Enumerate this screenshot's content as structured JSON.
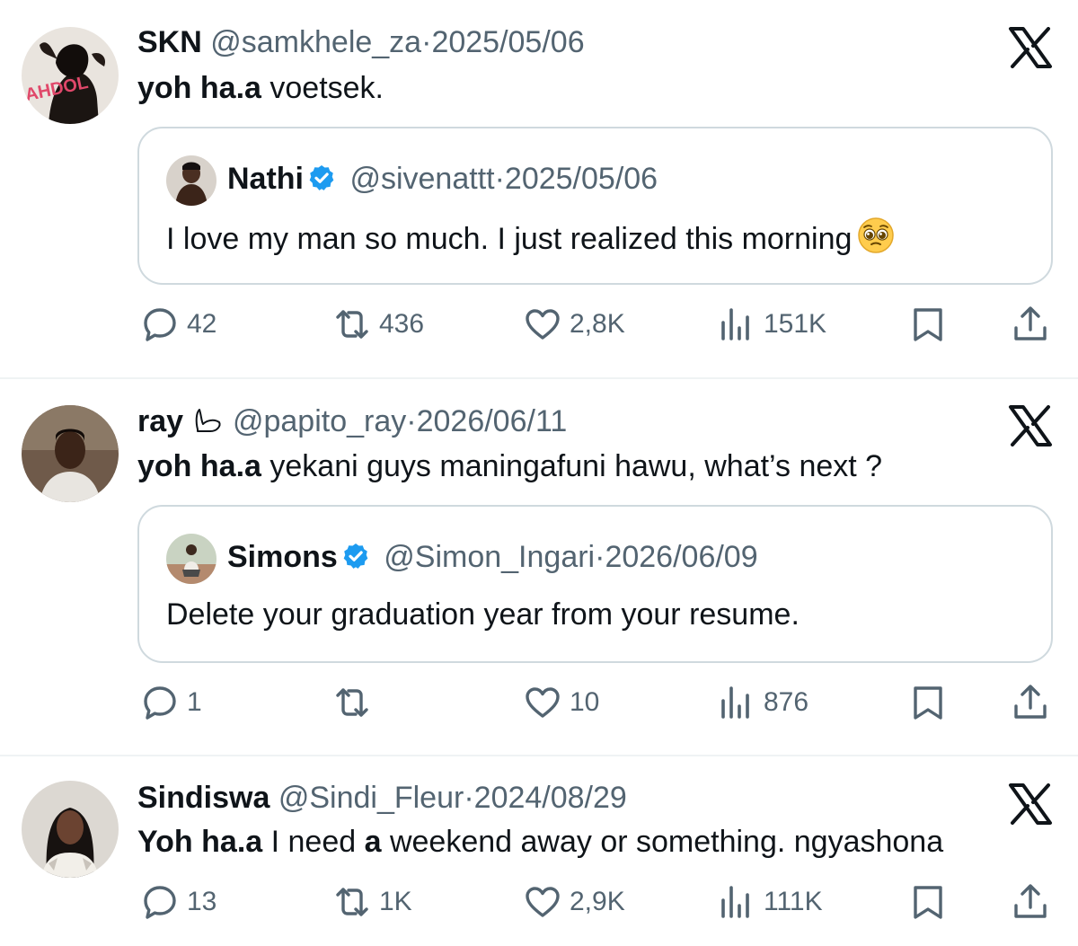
{
  "tweets": [
    {
      "name": "SKN",
      "handle": "@samkhele_za",
      "dot": "·",
      "date": "2025/05/06",
      "text_bold": "yoh ha.a",
      "text_rest": " voetsek.",
      "avatar_text": "AHDOL",
      "quote": {
        "name": "Nathi",
        "handle": "@sivenattt",
        "dot": "·",
        "date": "2025/05/06",
        "text": "I love my man so much. I just realized this morning",
        "emoji": "pleading-face"
      },
      "stats": {
        "replies": "42",
        "reposts": "436",
        "likes": "2,8K",
        "views": "151K"
      }
    },
    {
      "name": "ray",
      "handle": "@papito_ray",
      "dot": "·",
      "date": "2026/06/11",
      "name_glyph": "whale-outline-icon",
      "text_bold": "yoh ha.a",
      "text_rest": " yekani guys maningafuni hawu, what’s next ?",
      "quote": {
        "name": "Simons",
        "handle": "@Simon_Ingari",
        "dot": "·",
        "date": "2026/06/09",
        "text": "Delete your graduation year from your resume."
      },
      "stats": {
        "replies": "1",
        "reposts": "",
        "likes": "10",
        "views": "876"
      }
    },
    {
      "name": "Sindiswa",
      "handle": "@Sindi_Fleur",
      "dot": "·",
      "date": "2024/08/29",
      "text_bold": "Yoh ha.a",
      "text_mid": " I need ",
      "text_bold2": "a",
      "text_rest": " weekend away or something. ngyashona",
      "stats": {
        "replies": "13",
        "reposts": "1K",
        "likes": "2,9K",
        "views": "111K"
      }
    }
  ],
  "colors": {
    "text": "#0f1419",
    "muted": "#536471",
    "verified": "#1d9bf0",
    "border": "#cfd9de",
    "divider": "#eff3f4"
  }
}
